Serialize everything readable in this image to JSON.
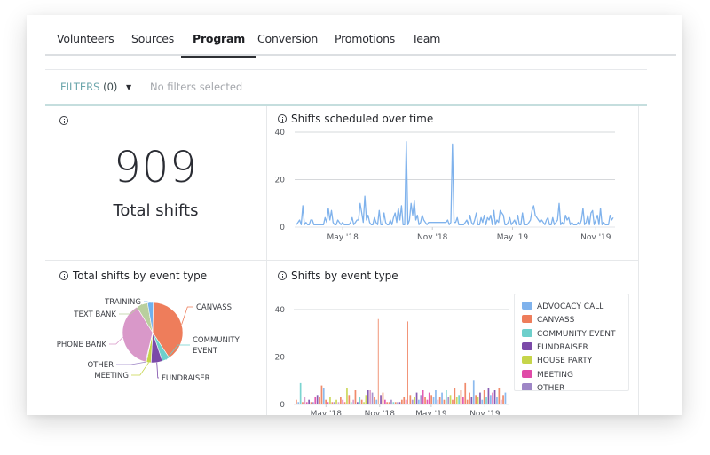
{
  "tabs": [
    {
      "label": "Volunteers",
      "active": false
    },
    {
      "label": "Sources",
      "active": false
    },
    {
      "label": "Program",
      "active": true
    },
    {
      "label": "Conversion",
      "active": false
    },
    {
      "label": "Promotions",
      "active": false
    },
    {
      "label": "Team",
      "active": false
    }
  ],
  "filters": {
    "label": "FILTERS",
    "count": "(0)",
    "status": "No filters selected"
  },
  "kpi": {
    "value": "909",
    "label": "Total shifts"
  },
  "panels": {
    "line_title": "Shifts scheduled over time",
    "pie_title": "Total shifts by event type",
    "bar_title": "Shifts by event type"
  },
  "colors": {
    "accent": "#6aa5ab",
    "line": "#7fb2ec",
    "gridline": "#d6d8db"
  },
  "chart_data": [
    {
      "type": "line",
      "title": "Shifts scheduled over time",
      "xlabel": "",
      "ylabel": "",
      "ylim": [
        0,
        40
      ],
      "yticks": [
        "0",
        "20",
        "40"
      ],
      "xticks": [
        "May '18",
        "Nov '18",
        "May '19",
        "Nov '19"
      ],
      "xrange": [
        "Feb 2018",
        "Jan 2020"
      ],
      "grid": true,
      "series": [
        {
          "name": "Shifts",
          "color": "#7fb2ec",
          "values": [
            1,
            2,
            3,
            1,
            9,
            1,
            2,
            1,
            1,
            3,
            3,
            1,
            1,
            1,
            1,
            1,
            1,
            1,
            4,
            2,
            8,
            3,
            7,
            2,
            1,
            1,
            3,
            2,
            1,
            2,
            1,
            1,
            1,
            1,
            2,
            4,
            1,
            2,
            3,
            3,
            10,
            6,
            2,
            13,
            3,
            5,
            2,
            1,
            1,
            4,
            2,
            1,
            7,
            1,
            1,
            6,
            2,
            1,
            1,
            3,
            1,
            4,
            6,
            2,
            8,
            3,
            9,
            1,
            1,
            36,
            1,
            3,
            10,
            5,
            11,
            3,
            5,
            1,
            2,
            5,
            3,
            2,
            1,
            2,
            2,
            2,
            2,
            2,
            2,
            2,
            2,
            2,
            2,
            2,
            2,
            3,
            1,
            2,
            35,
            2,
            2,
            4,
            1,
            1,
            1,
            1,
            2,
            3,
            1,
            5,
            2,
            1,
            3,
            6,
            1,
            1,
            4,
            2,
            5,
            1,
            4,
            3,
            5,
            1,
            7,
            1,
            3,
            2,
            7,
            6,
            5,
            1,
            1,
            2,
            4,
            1,
            2,
            3,
            1,
            5,
            1,
            1,
            6,
            1,
            1,
            1,
            2,
            3,
            7,
            9,
            5,
            4,
            3,
            2,
            3,
            2,
            1,
            3,
            4,
            1,
            1,
            4,
            1,
            2,
            3,
            10,
            1,
            2,
            1,
            5,
            3,
            4,
            1,
            2,
            1,
            1,
            1,
            2,
            1,
            3,
            8,
            1,
            2,
            5,
            1,
            6,
            7,
            1,
            3,
            5,
            1,
            8,
            1,
            2,
            1,
            1,
            1,
            5,
            3,
            4
          ]
        }
      ]
    },
    {
      "type": "pie",
      "title": "Total shifts by event type",
      "labels": [
        "CANVASS",
        "COMMUNITY EVENT",
        "FUNDRAISER",
        "MEETING",
        "OTHER",
        "PHONE BANK",
        "TEXT BANK",
        "TRAINING"
      ],
      "values": [
        40,
        4,
        6,
        2.5,
        0.5,
        37,
        6,
        3
      ],
      "unit": "percent (estimated)",
      "colors": [
        "#ee7d5b",
        "#6dcfcb",
        "#7b4aa8",
        "#c6d54a",
        "#9e86c6",
        "#d998c9",
        "#b9cf9e",
        "#6fb1ee"
      ]
    },
    {
      "type": "bar",
      "stacked": true,
      "title": "Shifts by event type",
      "ylim": [
        0,
        40
      ],
      "yticks": [
        "0",
        "20",
        "40"
      ],
      "xticks": [
        "May '18",
        "Nov '18",
        "May '19",
        "Nov '19"
      ],
      "grid": true,
      "legend": {
        "placement": "right",
        "entries": [
          {
            "label": "ADVOCACY CALL",
            "color": "#7fb2ec"
          },
          {
            "label": "CANVASS",
            "color": "#ee7d5b"
          },
          {
            "label": "COMMUNITY EVENT",
            "color": "#6dcfcb"
          },
          {
            "label": "FUNDRAISER",
            "color": "#7b4aa8"
          },
          {
            "label": "HOUSE PARTY",
            "color": "#c6d54a"
          },
          {
            "label": "MEETING",
            "color": "#e04aa8"
          },
          {
            "label": "OTHER",
            "color": "#9e86c6"
          }
        ]
      },
      "series_note": "Daily stacked bars, mostly 0-10 shifts; two canvass spikes near 36 (Oct '18) and 35 (Jan '19)",
      "values": [
        2,
        1,
        9,
        1,
        3,
        1,
        2,
        1,
        1,
        3,
        4,
        3,
        8,
        7,
        2,
        1,
        3,
        1,
        1,
        2,
        1,
        3,
        2,
        1,
        7,
        4,
        1,
        2,
        6,
        1,
        3,
        2,
        1,
        4,
        6,
        6,
        5,
        3,
        2,
        36,
        4,
        5,
        2,
        1,
        1,
        2,
        1,
        1,
        1,
        1,
        2,
        3,
        2,
        35,
        4,
        2,
        3,
        5,
        2,
        4,
        6,
        3,
        2,
        5,
        4,
        3,
        6,
        2,
        3,
        5,
        2,
        6,
        3,
        4,
        2,
        7,
        3,
        4,
        6,
        3,
        9,
        2,
        5,
        3,
        10,
        4,
        3,
        5,
        2,
        6,
        3,
        7,
        4,
        5,
        6,
        3,
        7,
        2,
        4,
        5
      ]
    }
  ]
}
